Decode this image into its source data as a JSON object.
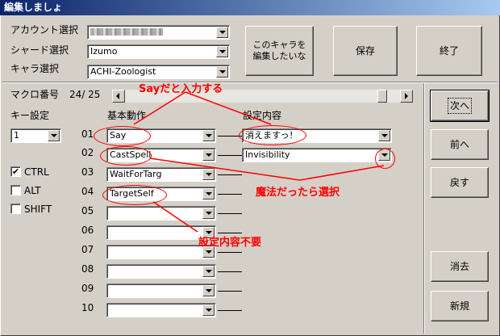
{
  "window": {
    "title": "編集しましょ"
  },
  "header": {
    "account_label": "アカウント選択",
    "account_value": "",
    "shard_label": "シャード選択",
    "shard_value": "Izumo",
    "char_label": "キャラ選択",
    "char_value": "ACHI-Zoologist",
    "edit_char_button": "このキャラを編集したいな",
    "save_button": "保存",
    "exit_button": "終了"
  },
  "macro": {
    "number_label": "マクロ番号",
    "number_value": "24/ 25",
    "key_setting_label": "キー設定",
    "key_value": "1",
    "basic_action_header": "基本動作",
    "setting_content_header": "設定内容",
    "modifiers": [
      {
        "label": "CTRL",
        "checked": true,
        "mark": "✔"
      },
      {
        "label": "ALT",
        "checked": false,
        "mark": ""
      },
      {
        "label": "SHIFT",
        "checked": false,
        "mark": ""
      }
    ],
    "rows": [
      {
        "num": "01",
        "action": "Say",
        "setting": "消えますっ！"
      },
      {
        "num": "02",
        "action": "CastSpell",
        "setting": "Invisibility"
      },
      {
        "num": "03",
        "action": "WaitForTarg",
        "setting": null
      },
      {
        "num": "04",
        "action": "TargetSelf",
        "setting": null
      },
      {
        "num": "05",
        "action": "",
        "setting": null
      },
      {
        "num": "06",
        "action": "",
        "setting": null
      },
      {
        "num": "07",
        "action": "",
        "setting": null
      },
      {
        "num": "08",
        "action": "",
        "setting": null
      },
      {
        "num": "09",
        "action": "",
        "setting": null
      },
      {
        "num": "10",
        "action": "",
        "setting": null
      }
    ]
  },
  "side_buttons": {
    "next": "次へ",
    "prev": "前へ",
    "back": "戻す",
    "delete": "消去",
    "new": "新規"
  },
  "annotations": {
    "say_note": "Sayだと入力する",
    "magic_note": "魔法だったら選択",
    "no_setting_note": "設定内容不要",
    "color": "#ff0000"
  }
}
